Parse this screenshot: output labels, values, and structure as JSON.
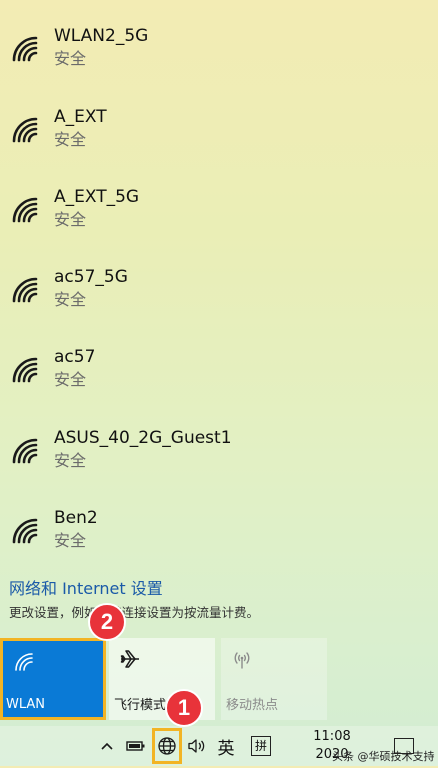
{
  "networks": [
    {
      "name": "WLAN2_5G",
      "status": "安全"
    },
    {
      "name": "A_EXT",
      "status": "安全"
    },
    {
      "name": "A_EXT_5G",
      "status": "安全"
    },
    {
      "name": "ac57_5G",
      "status": "安全"
    },
    {
      "name": "ac57",
      "status": "安全"
    },
    {
      "name": "ASUS_40_2G_Guest1",
      "status": "安全"
    },
    {
      "name": "Ben2",
      "status": "安全"
    }
  ],
  "settings": {
    "link": "网络和 Internet 设置",
    "description": "更改设置，例如将某连接设置为按流量计费。"
  },
  "tiles": {
    "wlan": {
      "label": "WLAN",
      "icon": "wifi-icon",
      "state": "on"
    },
    "airplane": {
      "label": "飞行模式",
      "icon": "airplane-icon"
    },
    "hotspot": {
      "label": "移动热点",
      "icon": "hotspot-icon"
    }
  },
  "markers": {
    "one": "1",
    "two": "2"
  },
  "taskbar": {
    "ime_lang": "英",
    "ime_mode": "拼",
    "time": "11:08",
    "date": "2020"
  },
  "watermark": "头条 @华硕技术支持",
  "colors": {
    "accent": "#0a7ad6",
    "highlight": "#f2b424",
    "marker": "#e8333a",
    "link": "#1a5aa8"
  }
}
